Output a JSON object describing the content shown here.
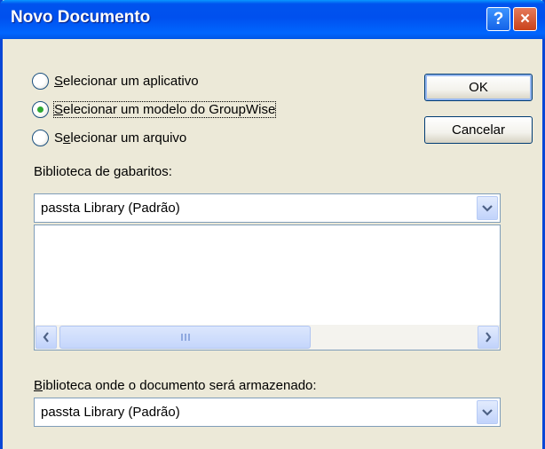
{
  "window": {
    "title": "Novo Documento",
    "help_label": "?",
    "close_label": "×"
  },
  "radios": [
    {
      "first": "S",
      "rest": "elecionar um aplicativo",
      "checked": false
    },
    {
      "first": "S",
      "rest": "elecionar um modelo do GroupWise",
      "checked": true
    },
    {
      "pre": "S",
      "ul": "e",
      "rest": "lecionar um arquivo",
      "checked": false
    }
  ],
  "buttons": {
    "ok": "OK",
    "cancel": "Cancelar"
  },
  "template_library": {
    "label": "Biblioteca de gabaritos:",
    "selected": "passta Library  (Padrão)"
  },
  "store_library": {
    "label_first": "B",
    "label_rest": "iblioteca onde o documento será armazenado:",
    "selected": "passta Library  (Padrão)"
  },
  "colors": {
    "title_bar": "#0054e3",
    "dialog_bg": "#ece9d8",
    "radio_dot": "#2fa833"
  }
}
